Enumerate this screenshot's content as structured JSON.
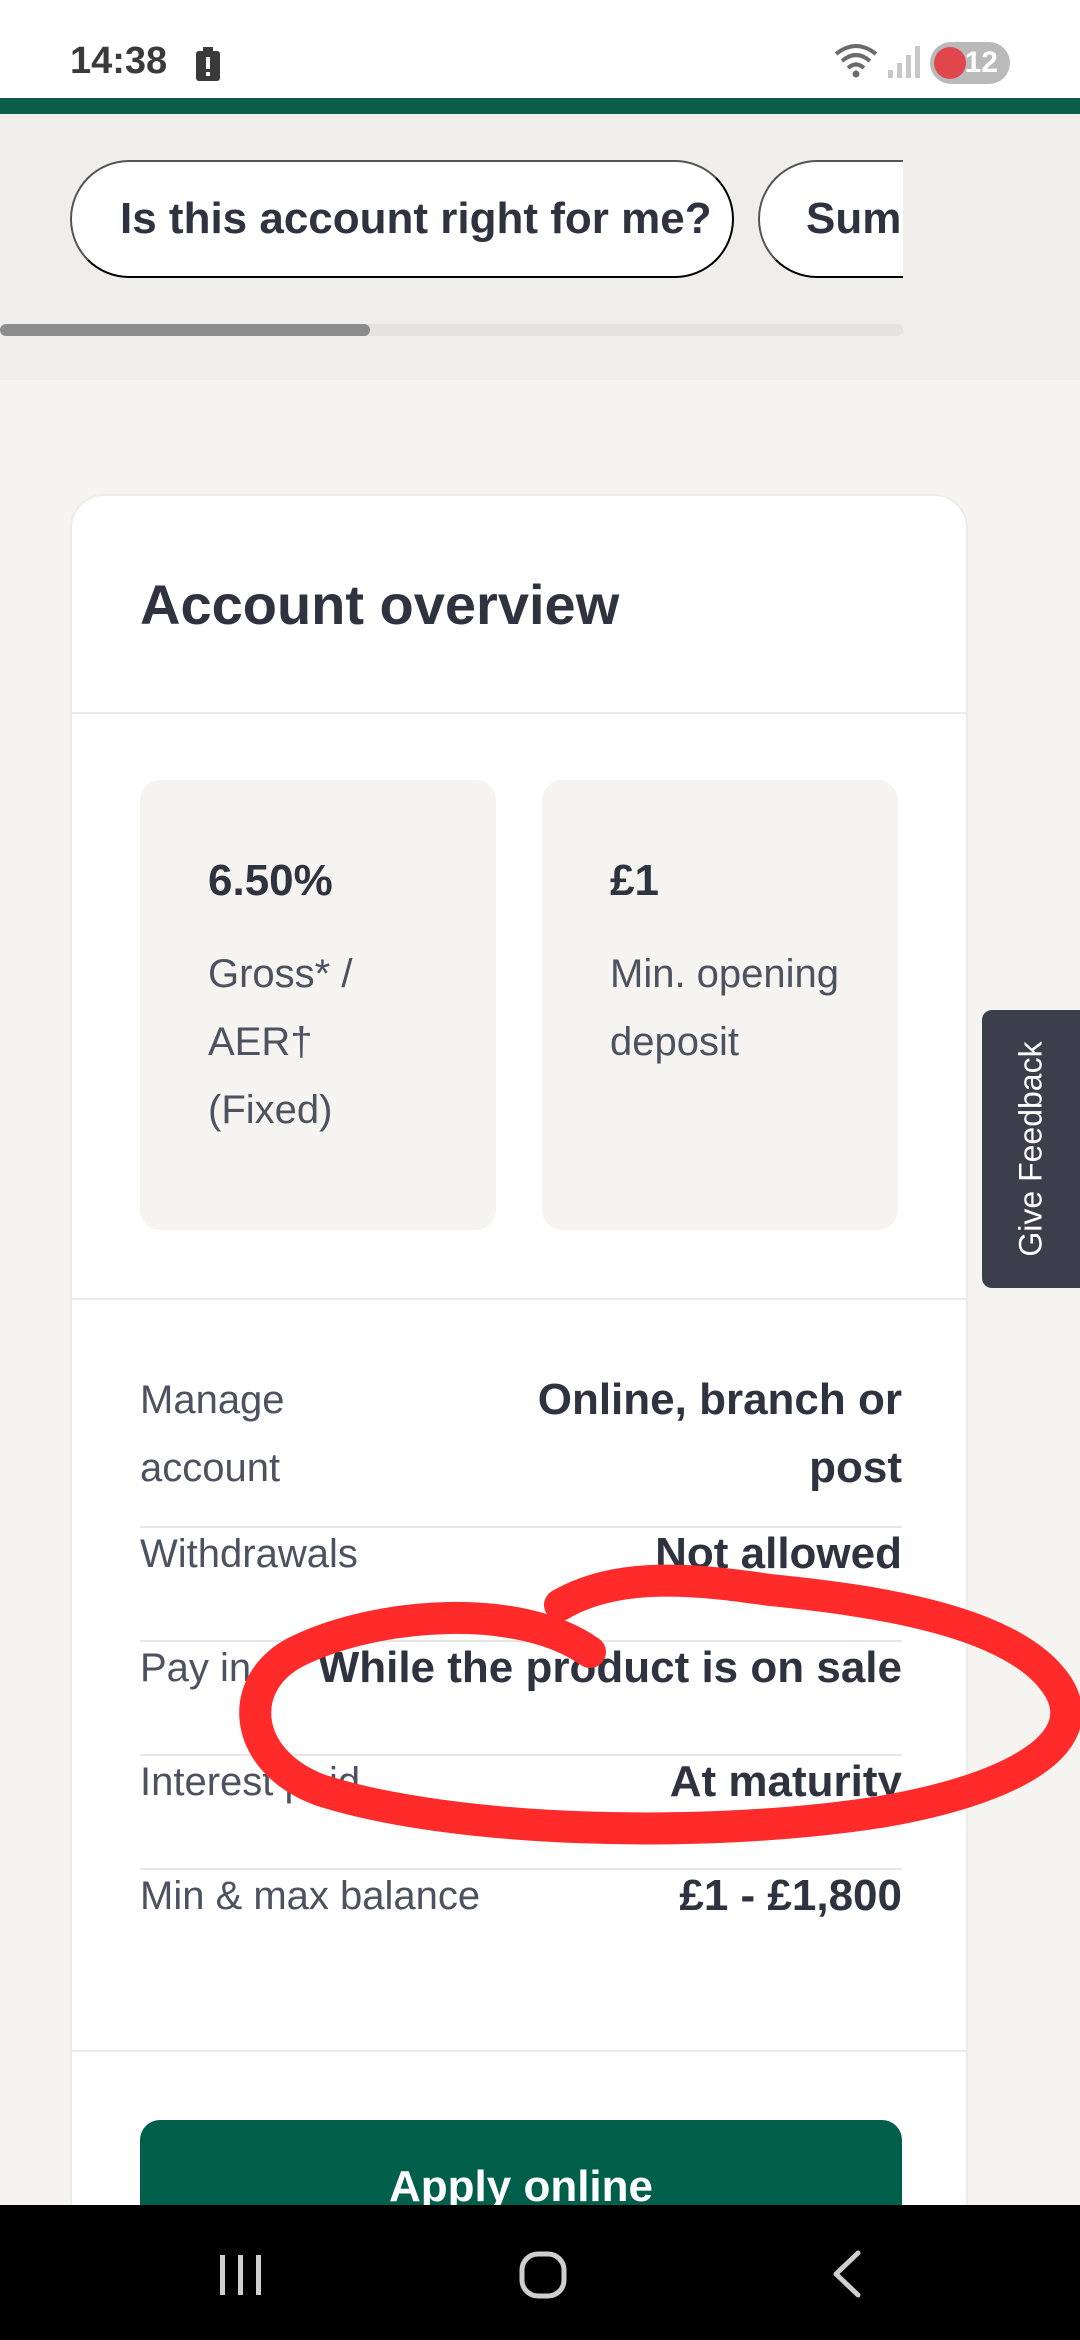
{
  "status_bar": {
    "time": "14:38",
    "battery_level": "12",
    "icons": [
      "battery-saver-icon",
      "wifi-icon",
      "signal-icon"
    ]
  },
  "chips": [
    {
      "label": "Is this account right for me?"
    },
    {
      "label": "Summ"
    }
  ],
  "card": {
    "title": "Account overview",
    "stats": [
      {
        "value": "6.50%",
        "label": "Gross* / AER† (Fixed)"
      },
      {
        "value": "£1",
        "label": "Min. opening deposit"
      }
    ],
    "details": [
      {
        "label": "Manage account",
        "value": "Online, branch or post"
      },
      {
        "label": "Withdrawals",
        "value": "Not allowed"
      },
      {
        "label": "Pay in",
        "value": "While the product is on sale"
      },
      {
        "label": "Interest paid",
        "value": "At maturity"
      },
      {
        "label": "Min & max balance",
        "value": "£1 - £1,800"
      }
    ],
    "apply_label": "Apply online"
  },
  "feedback": {
    "label": "Give Feedback"
  },
  "colors": {
    "brand_green": "#005f4b",
    "annotation_red": "#ff2a2a",
    "feedback_bg": "#3b3f4c"
  },
  "nav_bar": {
    "icons": [
      "recent-apps-icon",
      "home-icon",
      "back-icon"
    ]
  }
}
